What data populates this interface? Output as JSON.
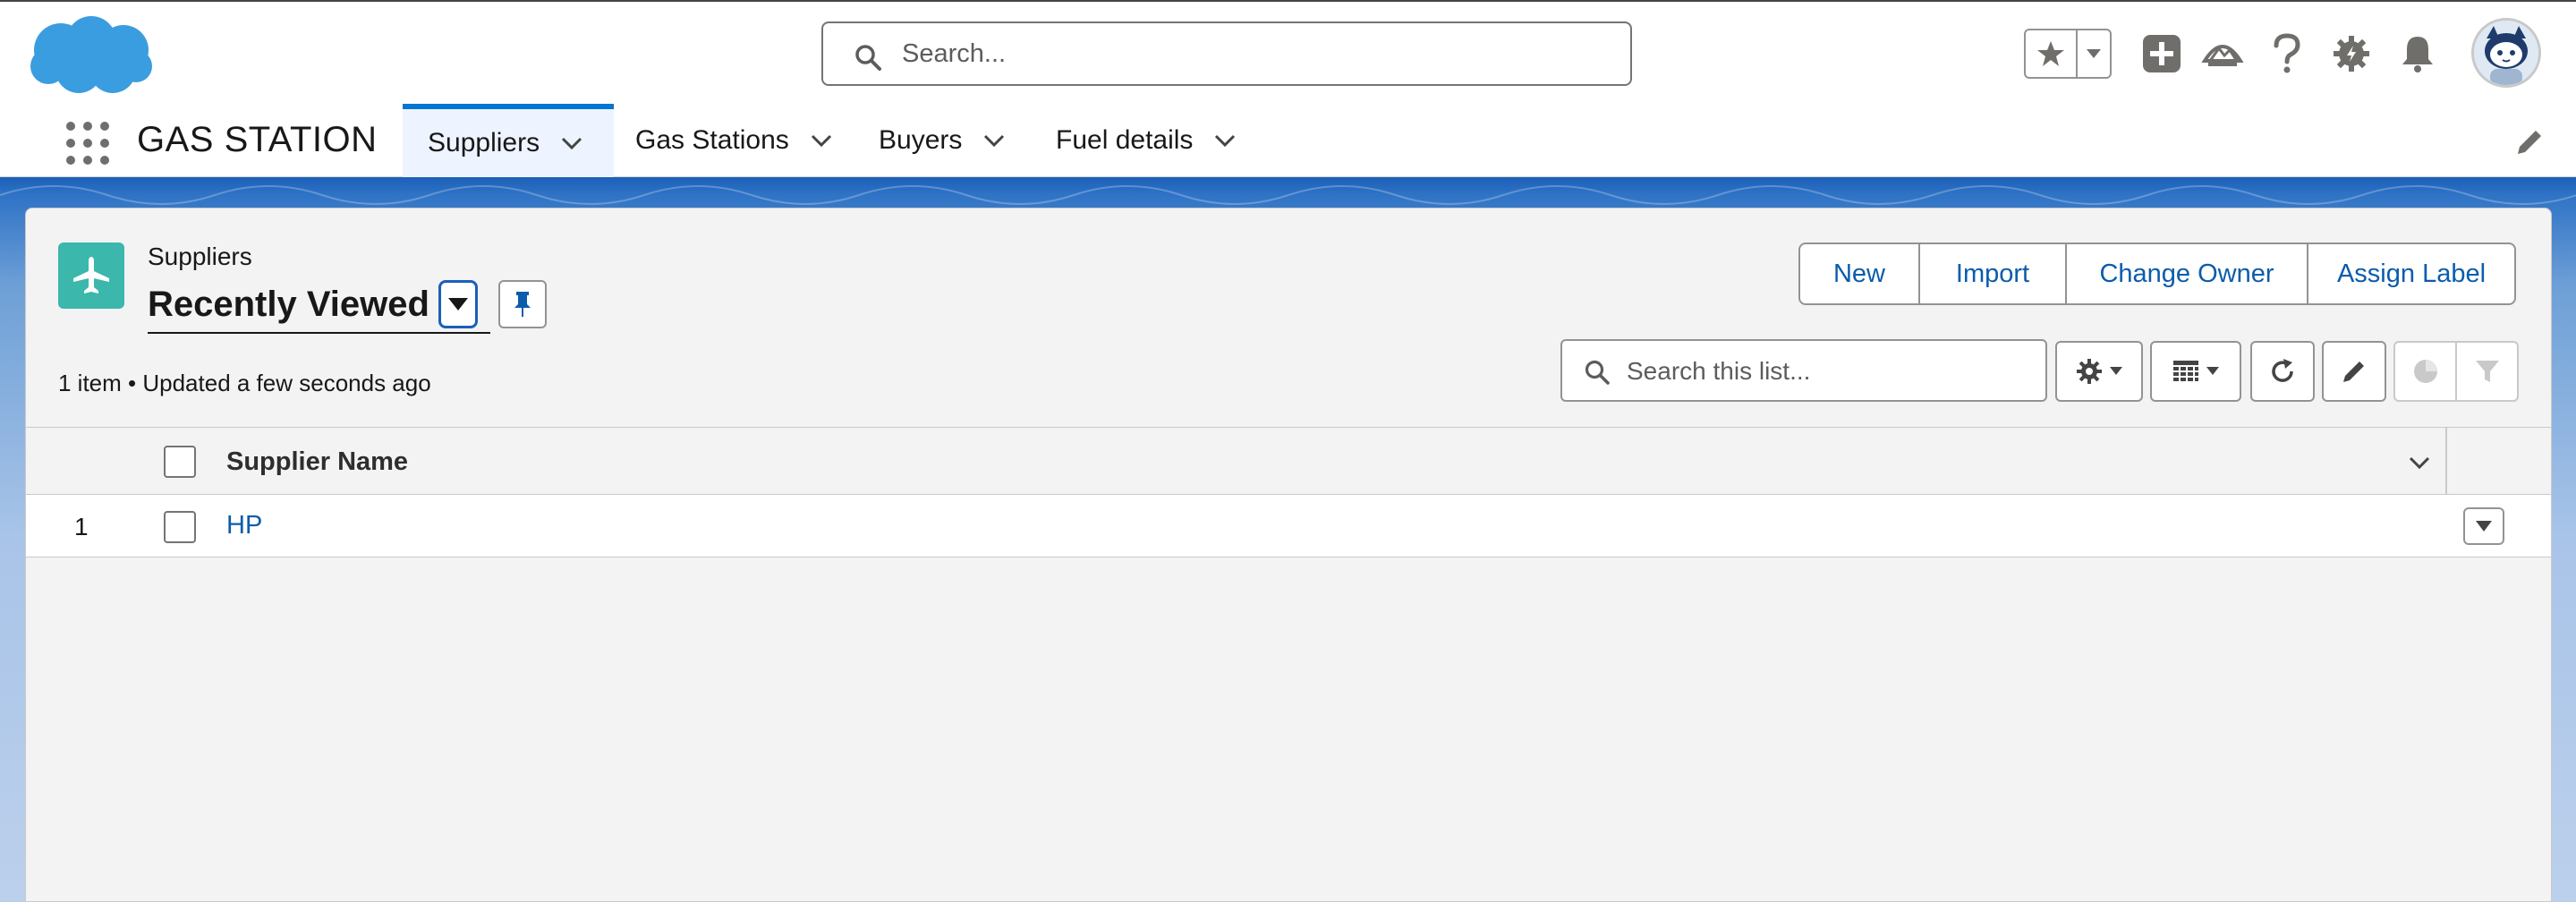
{
  "header": {
    "search_placeholder": "Search...",
    "icons": [
      "salesforce-cloud-logo",
      "favorite-star-icon",
      "global-create-icon",
      "trailhead-icon",
      "help-icon",
      "setup-gear-icon",
      "notifications-bell-icon",
      "user-avatar"
    ]
  },
  "nav": {
    "app_name": "GAS STATION",
    "tabs": [
      {
        "label": "Suppliers",
        "active": true
      },
      {
        "label": "Gas Stations",
        "active": false
      },
      {
        "label": "Buyers",
        "active": false
      },
      {
        "label": "Fuel details",
        "active": false
      }
    ]
  },
  "list": {
    "object_label": "Suppliers",
    "view_name": "Recently Viewed",
    "status": "1 item • Updated a few seconds ago",
    "search_placeholder": "Search this list...",
    "actions": [
      "New",
      "Import",
      "Change Owner",
      "Assign Label"
    ],
    "columns": [
      "Supplier Name"
    ],
    "rows": [
      {
        "num": "1",
        "name": "HP"
      }
    ]
  },
  "colors": {
    "brand_blue": "#0176d3",
    "link_blue": "#0b5cab",
    "object_icon": "#3bb7ac",
    "cloud_blue": "#3a9de0"
  }
}
